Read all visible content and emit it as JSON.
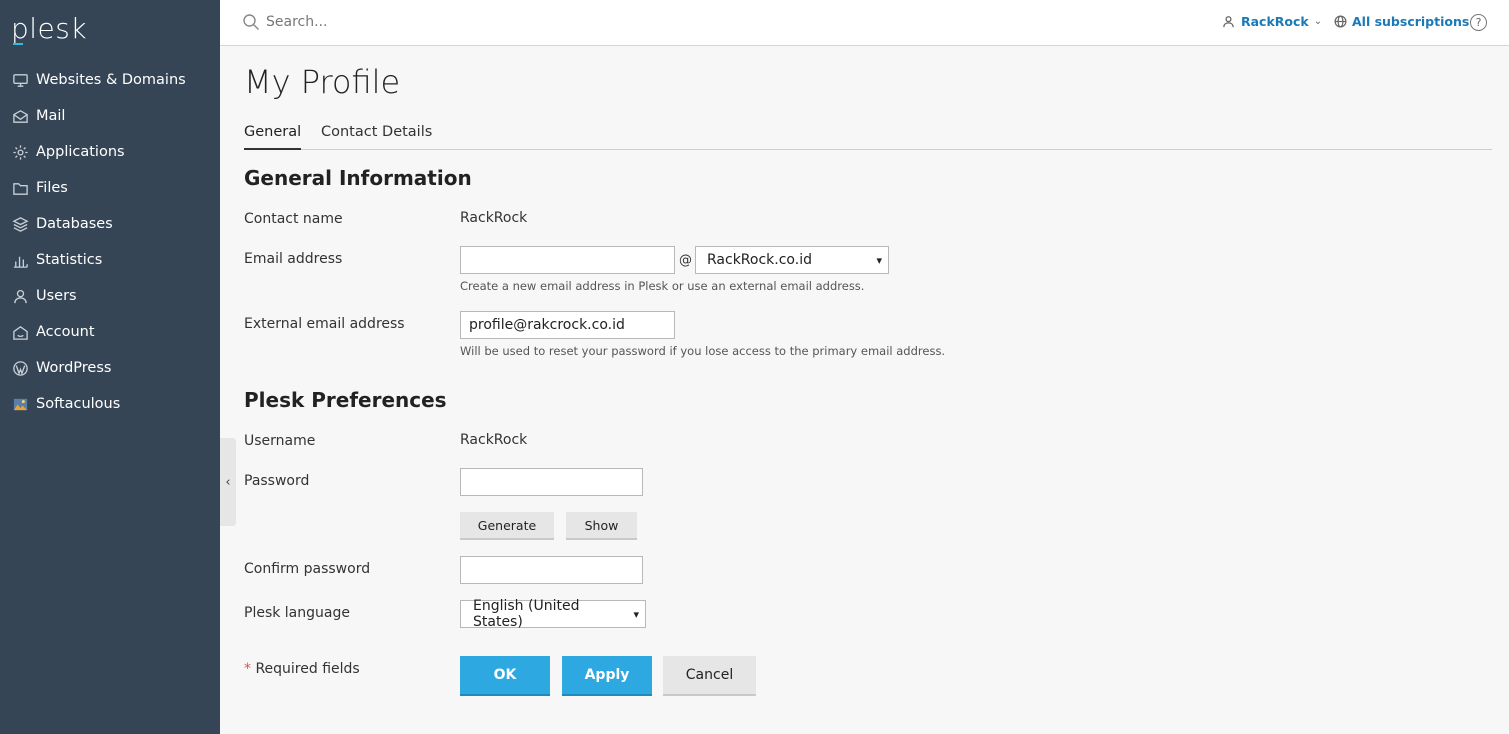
{
  "app": {
    "logo": "plesk"
  },
  "sidebar": {
    "items": [
      {
        "label": "Websites & Domains",
        "icon": "monitor-icon"
      },
      {
        "label": "Mail",
        "icon": "mail-icon"
      },
      {
        "label": "Applications",
        "icon": "gear-icon"
      },
      {
        "label": "Files",
        "icon": "folder-icon"
      },
      {
        "label": "Databases",
        "icon": "database-icon"
      },
      {
        "label": "Statistics",
        "icon": "bar-chart-icon"
      },
      {
        "label": "Users",
        "icon": "user-icon"
      },
      {
        "label": "Account",
        "icon": "account-icon"
      },
      {
        "label": "WordPress",
        "icon": "wordpress-icon"
      },
      {
        "label": "Softaculous",
        "icon": "softaculous-icon"
      }
    ]
  },
  "topbar": {
    "search_placeholder": "Search...",
    "user_label": "RackRock",
    "subscriptions_label": "All subscriptions",
    "help_label": "?"
  },
  "page": {
    "title": "My Profile",
    "tabs": [
      {
        "label": "General",
        "active": true
      },
      {
        "label": "Contact Details",
        "active": false
      }
    ]
  },
  "general_info": {
    "section_title": "General Information",
    "contact_name_label": "Contact name",
    "contact_name_value": "RackRock",
    "email_label": "Email address",
    "email_local_value": "",
    "email_at": "@",
    "email_domain_selected": "RackRock.co.id",
    "email_hint": "Create a new email address in Plesk or use an external email address.",
    "external_email_label": "External email address",
    "external_email_value": "profile@rakcrock.co.id",
    "external_email_hint": "Will be used to reset your password if you lose access to the primary email address."
  },
  "preferences": {
    "section_title": "Plesk Preferences",
    "username_label": "Username",
    "username_value": "RackRock",
    "password_label": "Password",
    "generate_label": "Generate",
    "show_label": "Show",
    "confirm_password_label": "Confirm password",
    "language_label": "Plesk language",
    "language_selected": "English (United States)"
  },
  "footer": {
    "required_star": "*",
    "required_text": " Required fields",
    "ok_label": "OK",
    "apply_label": "Apply",
    "cancel_label": "Cancel"
  },
  "colors": {
    "sidebar_bg": "#354555",
    "accent_blue": "#2ea8e0",
    "link_blue": "#1a7ab8"
  }
}
